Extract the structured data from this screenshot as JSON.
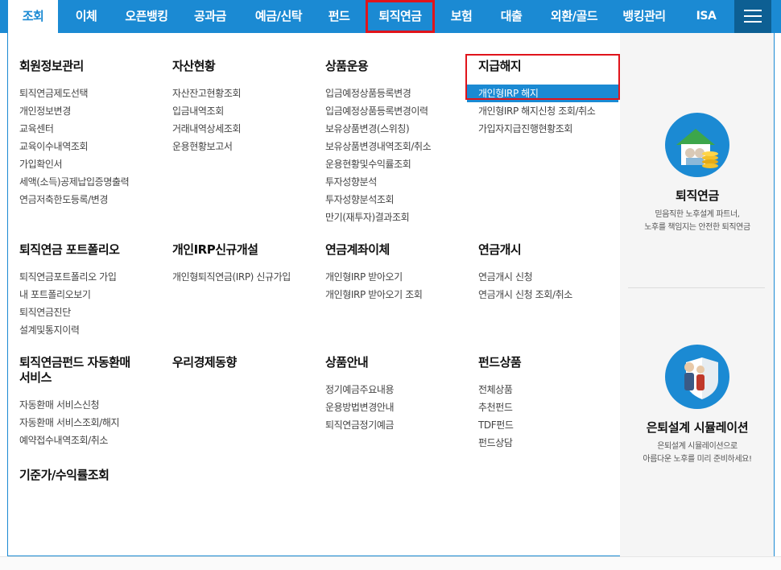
{
  "nav": {
    "items": [
      "조회",
      "이체",
      "오픈뱅킹",
      "공과금",
      "예금/신탁",
      "펀드",
      "퇴직연금",
      "보험",
      "대출",
      "외환/골드",
      "뱅킹관리",
      "ISA"
    ]
  },
  "menu": {
    "s1": {
      "title": "회원정보관리",
      "items": [
        "퇴직연금제도선택",
        "개인정보변경",
        "교육센터",
        "교육이수내역조회",
        "가입확인서",
        "세액(소득)공제납입증명출력",
        "연금저축한도등록/변경"
      ]
    },
    "s2": {
      "title": "자산현황",
      "items": [
        "자산잔고현황조회",
        "입금내역조회",
        "거래내역상세조회",
        "운용현황보고서"
      ]
    },
    "s3": {
      "title": "상품운용",
      "items": [
        "입금예정상품등록변경",
        "입금예정상품등록변경이력",
        "보유상품변경(스위칭)",
        "보유상품변경내역조회/취소",
        "운용현황및수익률조회",
        "투자성향분석",
        "투자성향분석조회",
        "만기(재투자)결과조회"
      ]
    },
    "s4": {
      "title": "지급해지",
      "items": [
        "개인형IRP 해지",
        "개인형IRP 해지신청 조회/취소",
        "가입자지급진행현황조회"
      ]
    },
    "s5": {
      "title": "퇴직연금 포트폴리오",
      "items": [
        "퇴직연금포트폴리오 가입",
        "내 포트폴리오보기",
        "퇴직연금진단",
        "설계및통지이력"
      ]
    },
    "s6": {
      "title": "개인IRP신규개설",
      "items": [
        "개인형퇴직연금(IRP) 신규가입"
      ]
    },
    "s7": {
      "title": "연금계좌이체",
      "items": [
        "개인형IRP 받아오기",
        "개인형IRP 받아오기 조회"
      ]
    },
    "s8": {
      "title": "연금개시",
      "items": [
        "연금개시 신청",
        "연금개시 신청 조회/취소"
      ]
    },
    "s9": {
      "title": "퇴직연금펀드 자동환매서비스",
      "items": [
        "자동환매 서비스신청",
        "자동환매 서비스조회/해지",
        "예약접수내역조회/취소"
      ]
    },
    "s10": {
      "title": "우리경제동향",
      "items": []
    },
    "s11": {
      "title": "상품안내",
      "items": [
        "정기예금주요내용",
        "운용방법변경안내",
        "퇴직연금정기예금"
      ]
    },
    "s12": {
      "title": "펀드상품",
      "items": [
        "전체상품",
        "추천펀드",
        "TDF펀드",
        "펀드상담"
      ]
    },
    "s13": {
      "title": "기준가/수익률조회",
      "items": []
    }
  },
  "promo": {
    "p1": {
      "title": "퇴직연금",
      "line1": "믿음직한 노후설계 파트너,",
      "line2": "노후를 책임지는 안전한 퇴직연금"
    },
    "p2": {
      "title": "은퇴설계 시뮬레이션",
      "line1": "은퇴설계 시뮬레이션으로",
      "line2": "아름다운 노후를 미리 준비하세요!"
    }
  },
  "colors": {
    "brand": "#1b8ad3",
    "highlight_border": "#e0141b"
  }
}
